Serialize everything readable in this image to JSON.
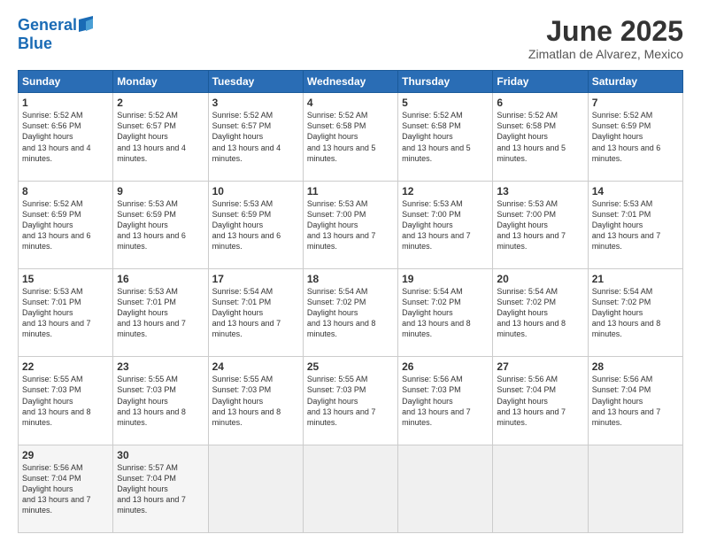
{
  "header": {
    "logo_line1": "General",
    "logo_line2": "Blue",
    "month": "June 2025",
    "location": "Zimatlan de Alvarez, Mexico"
  },
  "days_of_week": [
    "Sunday",
    "Monday",
    "Tuesday",
    "Wednesday",
    "Thursday",
    "Friday",
    "Saturday"
  ],
  "weeks": [
    [
      {
        "day": 1,
        "rise": "5:52 AM",
        "set": "6:56 PM",
        "daylight": "13 hours and 4 minutes."
      },
      {
        "day": 2,
        "rise": "5:52 AM",
        "set": "6:57 PM",
        "daylight": "13 hours and 4 minutes."
      },
      {
        "day": 3,
        "rise": "5:52 AM",
        "set": "6:57 PM",
        "daylight": "13 hours and 4 minutes."
      },
      {
        "day": 4,
        "rise": "5:52 AM",
        "set": "6:58 PM",
        "daylight": "13 hours and 5 minutes."
      },
      {
        "day": 5,
        "rise": "5:52 AM",
        "set": "6:58 PM",
        "daylight": "13 hours and 5 minutes."
      },
      {
        "day": 6,
        "rise": "5:52 AM",
        "set": "6:58 PM",
        "daylight": "13 hours and 5 minutes."
      },
      {
        "day": 7,
        "rise": "5:52 AM",
        "set": "6:59 PM",
        "daylight": "13 hours and 6 minutes."
      }
    ],
    [
      {
        "day": 8,
        "rise": "5:52 AM",
        "set": "6:59 PM",
        "daylight": "13 hours and 6 minutes."
      },
      {
        "day": 9,
        "rise": "5:53 AM",
        "set": "6:59 PM",
        "daylight": "13 hours and 6 minutes."
      },
      {
        "day": 10,
        "rise": "5:53 AM",
        "set": "6:59 PM",
        "daylight": "13 hours and 6 minutes."
      },
      {
        "day": 11,
        "rise": "5:53 AM",
        "set": "7:00 PM",
        "daylight": "13 hours and 7 minutes."
      },
      {
        "day": 12,
        "rise": "5:53 AM",
        "set": "7:00 PM",
        "daylight": "13 hours and 7 minutes."
      },
      {
        "day": 13,
        "rise": "5:53 AM",
        "set": "7:00 PM",
        "daylight": "13 hours and 7 minutes."
      },
      {
        "day": 14,
        "rise": "5:53 AM",
        "set": "7:01 PM",
        "daylight": "13 hours and 7 minutes."
      }
    ],
    [
      {
        "day": 15,
        "rise": "5:53 AM",
        "set": "7:01 PM",
        "daylight": "13 hours and 7 minutes."
      },
      {
        "day": 16,
        "rise": "5:53 AM",
        "set": "7:01 PM",
        "daylight": "13 hours and 7 minutes."
      },
      {
        "day": 17,
        "rise": "5:54 AM",
        "set": "7:01 PM",
        "daylight": "13 hours and 7 minutes."
      },
      {
        "day": 18,
        "rise": "5:54 AM",
        "set": "7:02 PM",
        "daylight": "13 hours and 8 minutes."
      },
      {
        "day": 19,
        "rise": "5:54 AM",
        "set": "7:02 PM",
        "daylight": "13 hours and 8 minutes."
      },
      {
        "day": 20,
        "rise": "5:54 AM",
        "set": "7:02 PM",
        "daylight": "13 hours and 8 minutes."
      },
      {
        "day": 21,
        "rise": "5:54 AM",
        "set": "7:02 PM",
        "daylight": "13 hours and 8 minutes."
      }
    ],
    [
      {
        "day": 22,
        "rise": "5:55 AM",
        "set": "7:03 PM",
        "daylight": "13 hours and 8 minutes."
      },
      {
        "day": 23,
        "rise": "5:55 AM",
        "set": "7:03 PM",
        "daylight": "13 hours and 8 minutes."
      },
      {
        "day": 24,
        "rise": "5:55 AM",
        "set": "7:03 PM",
        "daylight": "13 hours and 8 minutes."
      },
      {
        "day": 25,
        "rise": "5:55 AM",
        "set": "7:03 PM",
        "daylight": "13 hours and 7 minutes."
      },
      {
        "day": 26,
        "rise": "5:56 AM",
        "set": "7:03 PM",
        "daylight": "13 hours and 7 minutes."
      },
      {
        "day": 27,
        "rise": "5:56 AM",
        "set": "7:04 PM",
        "daylight": "13 hours and 7 minutes."
      },
      {
        "day": 28,
        "rise": "5:56 AM",
        "set": "7:04 PM",
        "daylight": "13 hours and 7 minutes."
      }
    ],
    [
      {
        "day": 29,
        "rise": "5:56 AM",
        "set": "7:04 PM",
        "daylight": "13 hours and 7 minutes."
      },
      {
        "day": 30,
        "rise": "5:57 AM",
        "set": "7:04 PM",
        "daylight": "13 hours and 7 minutes."
      },
      null,
      null,
      null,
      null,
      null
    ]
  ]
}
